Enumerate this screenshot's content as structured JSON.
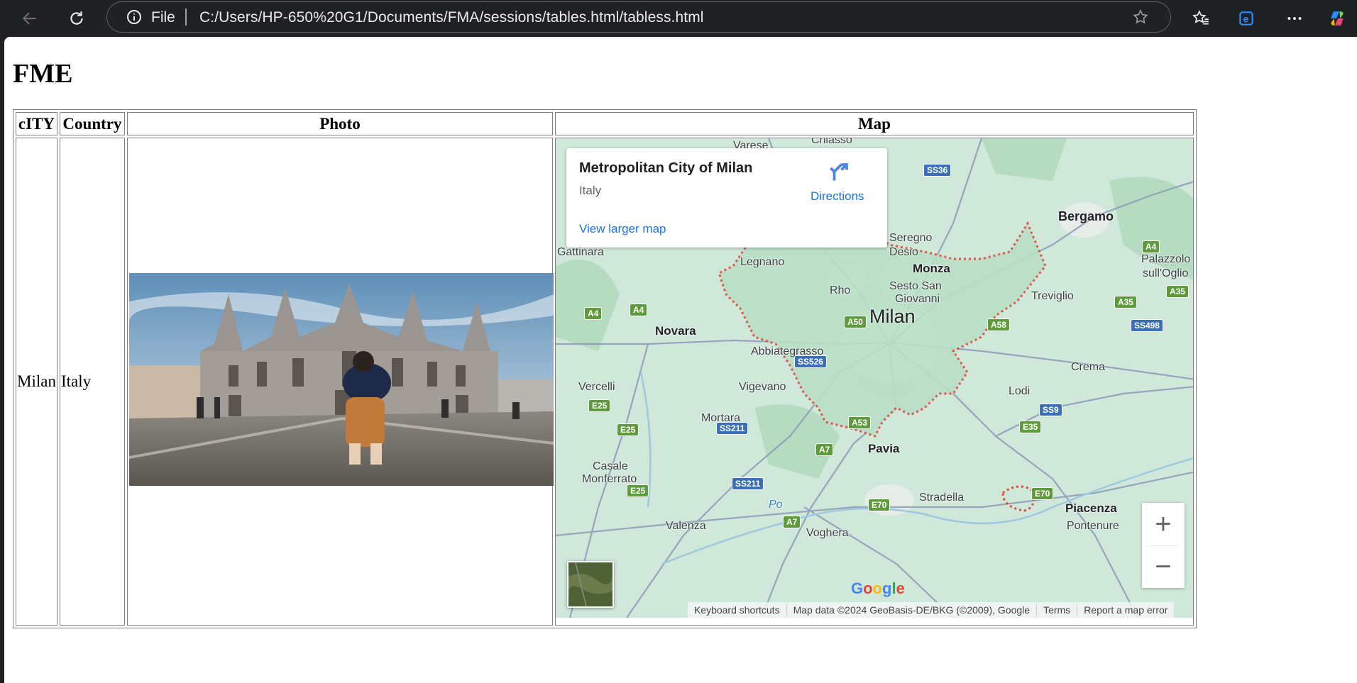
{
  "browser": {
    "scheme_label": "File",
    "url": "C:/Users/HP-650%20G1/Documents/FMA/sessions/tables.html/tabless.html"
  },
  "page": {
    "heading": "FME",
    "table": {
      "headers": [
        "cITY",
        "Country",
        "Photo",
        "Map"
      ],
      "rows": [
        {
          "city": "Milan",
          "country": "Italy"
        }
      ]
    }
  },
  "map": {
    "card": {
      "title": "Metropolitan City of Milan",
      "subtitle": "Italy",
      "directions_label": "Directions",
      "larger_map_link": "View larger map"
    },
    "places": {
      "milan": "Milan",
      "bergamo": "Bergamo",
      "monza": "Monza",
      "novara": "Novara",
      "pavia": "Pavia",
      "piacenza": "Piacenza",
      "lodi": "Lodi",
      "crema": "Crema",
      "treviglio": "Treviglio",
      "vigevano": "Vigevano",
      "vercelli": "Vercelli",
      "mortara": "Mortara",
      "abbiategrasso": "Abbiategrasso",
      "legnano": "Legnano",
      "rho": "Rho",
      "desio": "Desio",
      "seregno": "Seregno",
      "sesto1": "Sesto San",
      "sesto2": "Giovanni",
      "gattinara": "Gattinara",
      "casale1": "Casale",
      "casale2": "Monferrato",
      "valenza": "Valenza",
      "stradella": "Stradella",
      "palazzolo1": "Palazzolo",
      "palazzolo2": "sull'Oglio",
      "pontenure": "Pontenure",
      "voghera": "Voghera",
      "varese": "Varese",
      "chiasso": "Chiasso",
      "po": "Po"
    },
    "roads": {
      "ss36": "SS36",
      "a4a": "A4",
      "a4b": "A4",
      "a4c": "A4",
      "a50": "A50",
      "a58": "A58",
      "a35": "A35",
      "a35b": "A35",
      "ss498": "SS498",
      "ss526": "SS526",
      "e25a": "E25",
      "e25b": "E25",
      "e25c": "E25",
      "ss211a": "SS211",
      "ss211b": "SS211",
      "a53": "A53",
      "a7a": "A7",
      "a7b": "A7",
      "ss9": "SS9",
      "e35": "E35",
      "e70a": "E70",
      "e70b": "E70"
    },
    "google_logo": "Google",
    "attribution": {
      "shortcuts": "Keyboard shortcuts",
      "data": "Map data ©2024 GeoBasis-DE/BKG (©2009), Google",
      "terms": "Terms",
      "report": "Report a map error"
    },
    "zoom_in": "+",
    "zoom_out": "−"
  }
}
